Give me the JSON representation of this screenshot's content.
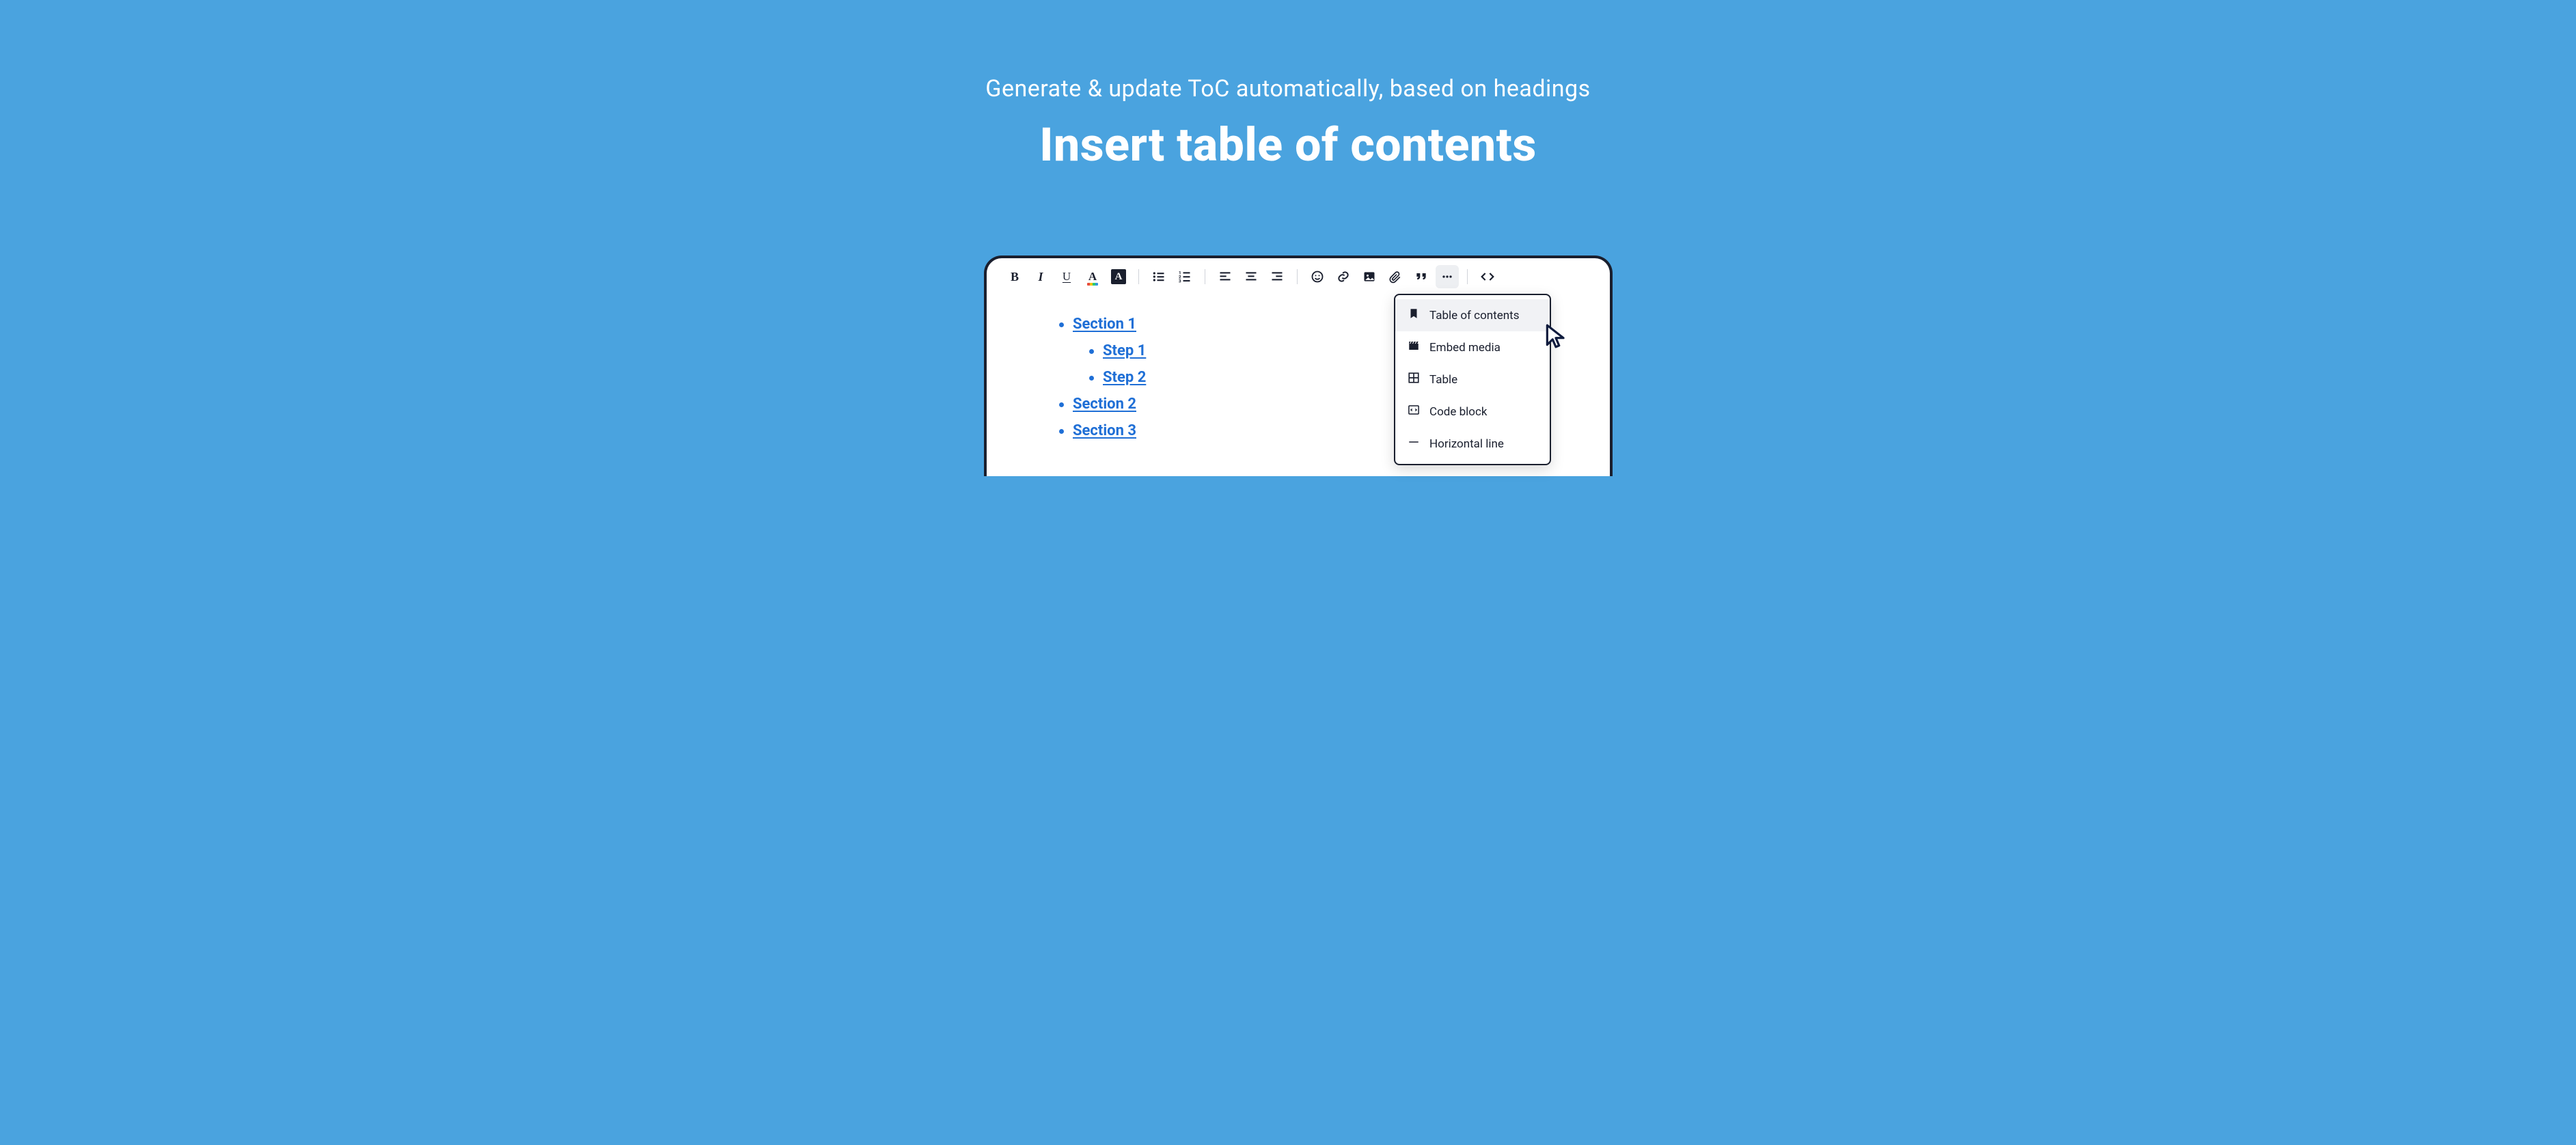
{
  "hero": {
    "subtitle": "Generate & update ToC automatically, based on headings",
    "title": "Insert table of contents"
  },
  "toc": {
    "items": [
      {
        "label": "Section 1",
        "children": [
          {
            "label": "Step 1"
          },
          {
            "label": "Step 2"
          }
        ]
      },
      {
        "label": "Section 2"
      },
      {
        "label": "Section 3"
      }
    ]
  },
  "dropdown": {
    "items": [
      {
        "label": "Table of contents",
        "icon": "bookmark"
      },
      {
        "label": "Embed media",
        "icon": "clapper"
      },
      {
        "label": "Table",
        "icon": "grid"
      },
      {
        "label": "Code block",
        "icon": "code"
      },
      {
        "label": "Horizontal line",
        "icon": "hr"
      }
    ]
  },
  "toolbar": {
    "icons": [
      "bold",
      "italic",
      "underline",
      "text-color",
      "bg-color",
      "|",
      "bullet-list",
      "numbered-list",
      "|",
      "align-left",
      "align-center",
      "align-right",
      "|",
      "emoji",
      "link",
      "image",
      "attachment",
      "quote",
      "more",
      "|",
      "code-view"
    ]
  }
}
